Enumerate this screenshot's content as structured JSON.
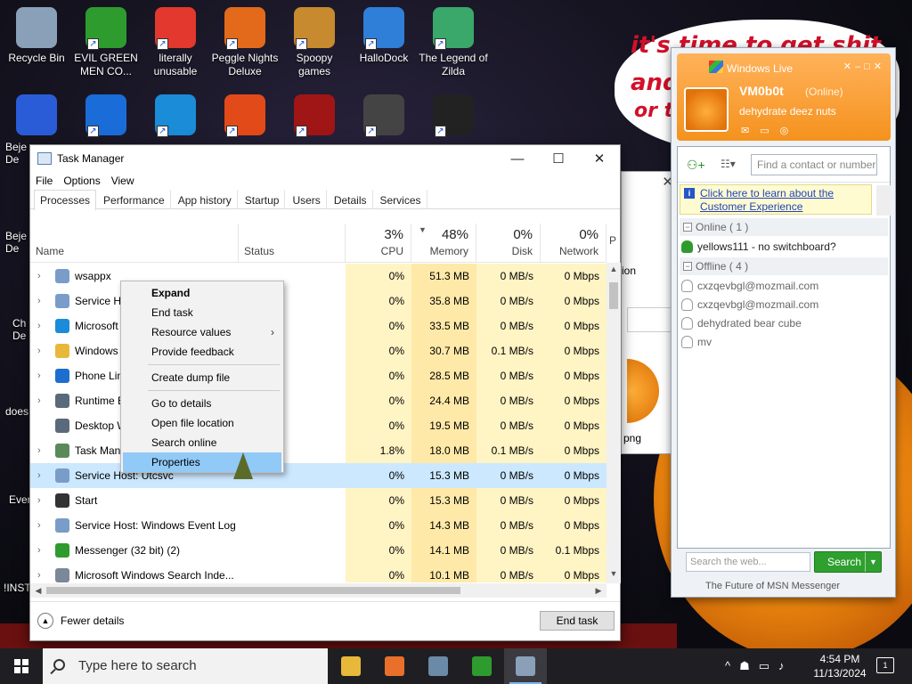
{
  "desktop": {
    "icons": [
      {
        "label": "Recycle Bin",
        "icon": "recycle-bin-icon",
        "color": "#8aa0b8"
      },
      {
        "label": "EVIL GREEN MEN CO...",
        "icon": "green-men-icon",
        "color": "#2e9b2e"
      },
      {
        "label": "literally unusable",
        "icon": "chrome-icon",
        "color": "#e2382d"
      },
      {
        "label": "Peggle Nights Deluxe",
        "icon": "peggle-icon",
        "color": "#e26a1a"
      },
      {
        "label": "Spoopy games",
        "icon": "folder-icon",
        "color": "#c88a2e"
      },
      {
        "label": "HalloDock",
        "icon": "windows-shield-icon",
        "color": "#2f7ed8"
      },
      {
        "label": "The Legend of Zilda",
        "icon": "zilda-icon",
        "color": "#3aa86a"
      }
    ],
    "row2_icons": [
      {
        "label": "",
        "icon": "bejeweled-icon",
        "color": "#2a5cd8"
      },
      {
        "label": "",
        "icon": "mpl-icon",
        "color": "#1a6cd8"
      },
      {
        "label": "",
        "icon": "edge-icon",
        "color": "#1a8cd8"
      },
      {
        "label": "",
        "icon": "peggle-icon",
        "color": "#e24a1a"
      },
      {
        "label": "",
        "icon": "flash-icon",
        "color": "#a01515"
      },
      {
        "label": "",
        "icon": "remote-icon",
        "color": "#444444"
      },
      {
        "label": "",
        "icon": "yashma-icon",
        "color": "#222222"
      }
    ],
    "side_labels": [
      "Beje De",
      "Beje De",
      "Ch De",
      "does",
      "Ever",
      "!INSTA"
    ],
    "wallpaper_text": [
      "it's time to get shit",
      "and",
      "or t"
    ]
  },
  "task_manager": {
    "title": "Task Manager",
    "menu": [
      "File",
      "Options",
      "View"
    ],
    "tabs": [
      "Processes",
      "Performance",
      "App history",
      "Startup",
      "Users",
      "Details",
      "Services"
    ],
    "active_tab": "Processes",
    "columns": {
      "name": "Name",
      "status": "Status",
      "cpu": {
        "pct": "3%",
        "label": "CPU"
      },
      "memory": {
        "pct": "48%",
        "label": "Memory"
      },
      "disk": {
        "pct": "0%",
        "label": "Disk"
      },
      "network": {
        "pct": "0%",
        "label": "Network"
      },
      "power": "P"
    },
    "processes": [
      {
        "name": "wsappx",
        "cpu": "0%",
        "memory": "51.3 MB",
        "disk": "0 MB/s",
        "network": "0 Mbps",
        "icon": "gear-icon",
        "color": "#7a9cc8",
        "expand": true
      },
      {
        "name": "Service Ho",
        "cpu": "0%",
        "memory": "35.8 MB",
        "disk": "0 MB/s",
        "network": "0 Mbps",
        "icon": "gear-icon",
        "color": "#7a9cc8",
        "expand": true
      },
      {
        "name": "Microsoft",
        "cpu": "0%",
        "memory": "33.5 MB",
        "disk": "0 MB/s",
        "network": "0 Mbps",
        "icon": "edge-icon",
        "color": "#1a8cd8",
        "expand": true
      },
      {
        "name": "Windows",
        "cpu": "0%",
        "memory": "30.7 MB",
        "disk": "0.1 MB/s",
        "network": "0 Mbps",
        "icon": "folder-icon",
        "color": "#e8b83a",
        "expand": true
      },
      {
        "name": "Phone Lin",
        "cpu": "0%",
        "memory": "28.5 MB",
        "disk": "0 MB/s",
        "network": "0 Mbps",
        "icon": "phone-icon",
        "color": "#1e6ed0",
        "expand": true
      },
      {
        "name": "Runtime B",
        "cpu": "0%",
        "memory": "24.4 MB",
        "disk": "0 MB/s",
        "network": "0 Mbps",
        "icon": "window-icon",
        "color": "#5a6a7a",
        "expand": true
      },
      {
        "name": "Desktop W",
        "cpu": "0%",
        "memory": "19.5 MB",
        "disk": "0 MB/s",
        "network": "0 Mbps",
        "icon": "window-icon",
        "color": "#5a6a7a",
        "expand": false
      },
      {
        "name": "Task Mana",
        "cpu": "1.8%",
        "memory": "18.0 MB",
        "disk": "0.1 MB/s",
        "network": "0 Mbps",
        "icon": "task-manager-icon",
        "color": "#5a8a5a",
        "expand": true
      },
      {
        "name": "Service Host: Utcsvc",
        "cpu": "0%",
        "memory": "15.3 MB",
        "disk": "0 MB/s",
        "network": "0 Mbps",
        "icon": "gear-icon",
        "color": "#7a9cc8",
        "expand": true,
        "selected": true
      },
      {
        "name": "Start",
        "cpu": "0%",
        "memory": "15.3 MB",
        "disk": "0 MB/s",
        "network": "0 Mbps",
        "icon": "window-icon",
        "color": "#333333",
        "expand": true
      },
      {
        "name": "Service Host: Windows Event Log",
        "cpu": "0%",
        "memory": "14.3 MB",
        "disk": "0 MB/s",
        "network": "0 Mbps",
        "icon": "gear-icon",
        "color": "#7a9cc8",
        "expand": true
      },
      {
        "name": "Messenger (32 bit) (2)",
        "cpu": "0%",
        "memory": "14.1 MB",
        "disk": "0 MB/s",
        "network": "0.1 Mbps",
        "icon": "messenger-icon",
        "color": "#2e9b2e",
        "expand": true
      },
      {
        "name": "Microsoft Windows Search Inde...",
        "cpu": "0%",
        "memory": "10.1 MB",
        "disk": "0 MB/s",
        "network": "0 Mbps",
        "icon": "search-indexer-icon",
        "color": "#7a8898",
        "expand": true
      }
    ],
    "fewer_details": "Fewer details",
    "end_task": "End task"
  },
  "context_menu": {
    "items": [
      {
        "label": "Expand",
        "bold": true
      },
      {
        "label": "End task"
      },
      {
        "label": "Resource values",
        "submenu": true
      },
      {
        "label": "Provide feedback"
      },
      {
        "separator": true
      },
      {
        "label": "Create dump file"
      },
      {
        "separator": true
      },
      {
        "label": "Go to details"
      },
      {
        "label": "Open file location"
      },
      {
        "label": "Search online"
      },
      {
        "label": "Properties",
        "highlighted": true
      }
    ],
    "submenu_glyph": "›"
  },
  "bg_window": {
    "text_ion": "ion",
    "text_png": "png"
  },
  "messenger": {
    "title": "Windows Live",
    "user": {
      "name": "VM0b0t",
      "status": "(Online)",
      "message": "dehydrate deez nuts"
    },
    "find_placeholder": "Find a contact or number",
    "info_link": "Click here to learn about the Customer Experience",
    "online_group": "Online ( 1 )",
    "online_contacts": [
      "yellows111 - no switchboard?"
    ],
    "offline_group": "Offline ( 4 )",
    "offline_contacts": [
      "cxzqevbgl@mozmail.com",
      "cxzqevbgl@mozmail.com",
      "dehydrated bear cube",
      "mv"
    ],
    "search_placeholder": "Search the web...",
    "search_button": "Search",
    "footer": "The Future of MSN Messenger",
    "accent": "#f5921e"
  },
  "taskbar": {
    "search_placeholder": "Type here to search",
    "apps": [
      {
        "name": "file-explorer",
        "icon": "folder-icon",
        "color": "#e8b83a"
      },
      {
        "name": "firefox",
        "icon": "firefox-icon",
        "color": "#e8702a"
      },
      {
        "name": "control-panel",
        "icon": "window-icon",
        "color": "#6a8aa8"
      },
      {
        "name": "messenger",
        "icon": "messenger-icon",
        "color": "#2e9b2e"
      },
      {
        "name": "task-manager",
        "icon": "task-manager-icon",
        "color": "#8aa0b8",
        "active": true
      }
    ],
    "time": "4:54 PM",
    "date": "11/13/2024",
    "notifications": "1"
  }
}
